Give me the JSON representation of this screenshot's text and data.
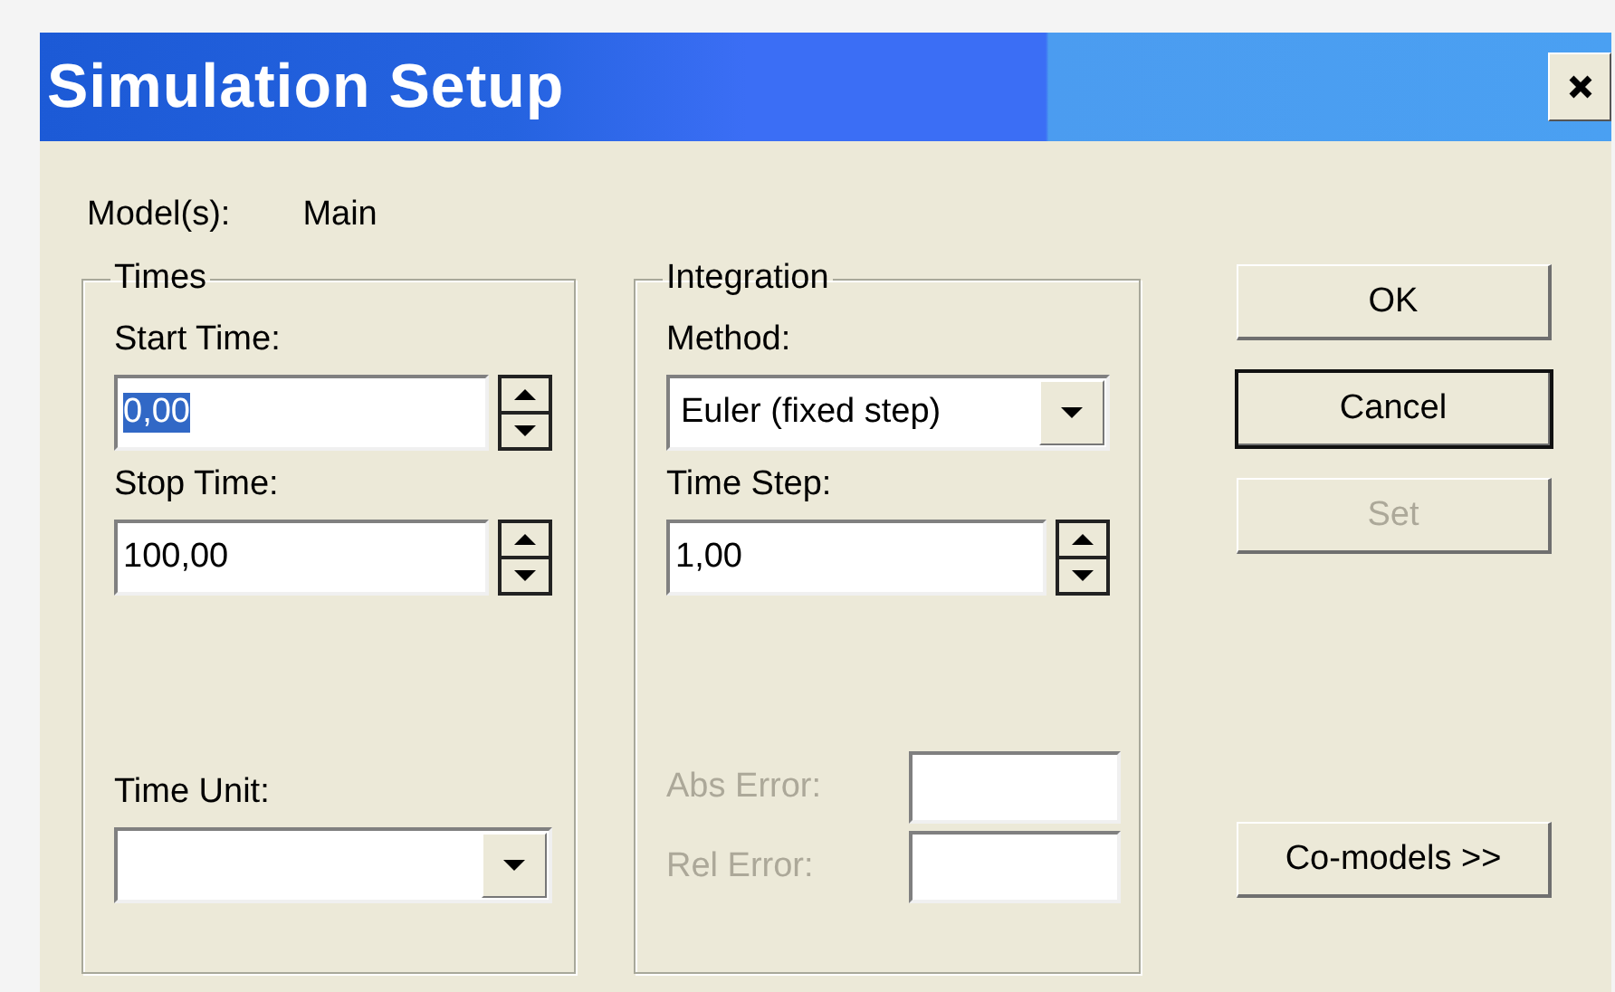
{
  "window": {
    "title": "Simulation Setup"
  },
  "models": {
    "label": "Model(s):",
    "value": "Main"
  },
  "groups": [
    {
      "title": "Times",
      "fields": [
        {
          "kind": "spin",
          "label": "Start Time:",
          "value": "0,00",
          "highlighted": true
        },
        {
          "kind": "spin",
          "label": "Stop Time:",
          "value": "100,00",
          "highlighted": false
        }
      ],
      "lower_fields": [
        {
          "kind": "combo",
          "label": "Time Unit:"
        }
      ]
    },
    {
      "title": "Integration",
      "fields": [
        {
          "kind": "combo",
          "label": "Method:",
          "value": "Euler (fixed step)"
        },
        {
          "kind": "spin",
          "label": "Time Step:",
          "value": "1,00",
          "highlighted": false
        }
      ],
      "lower_fields": [
        {
          "kind": "text",
          "label": "Abs Error:",
          "disabled": true
        },
        {
          "kind": "text",
          "label": "Rel Error:",
          "disabled": true
        }
      ]
    }
  ],
  "buttons": [
    {
      "label": "OK",
      "disabled": false,
      "default": false
    },
    {
      "label": "Cancel",
      "disabled": false,
      "default": true
    },
    {
      "label": "Set",
      "disabled": true,
      "default": false
    }
  ],
  "extra_button": {
    "label": "Co-models >>"
  }
}
